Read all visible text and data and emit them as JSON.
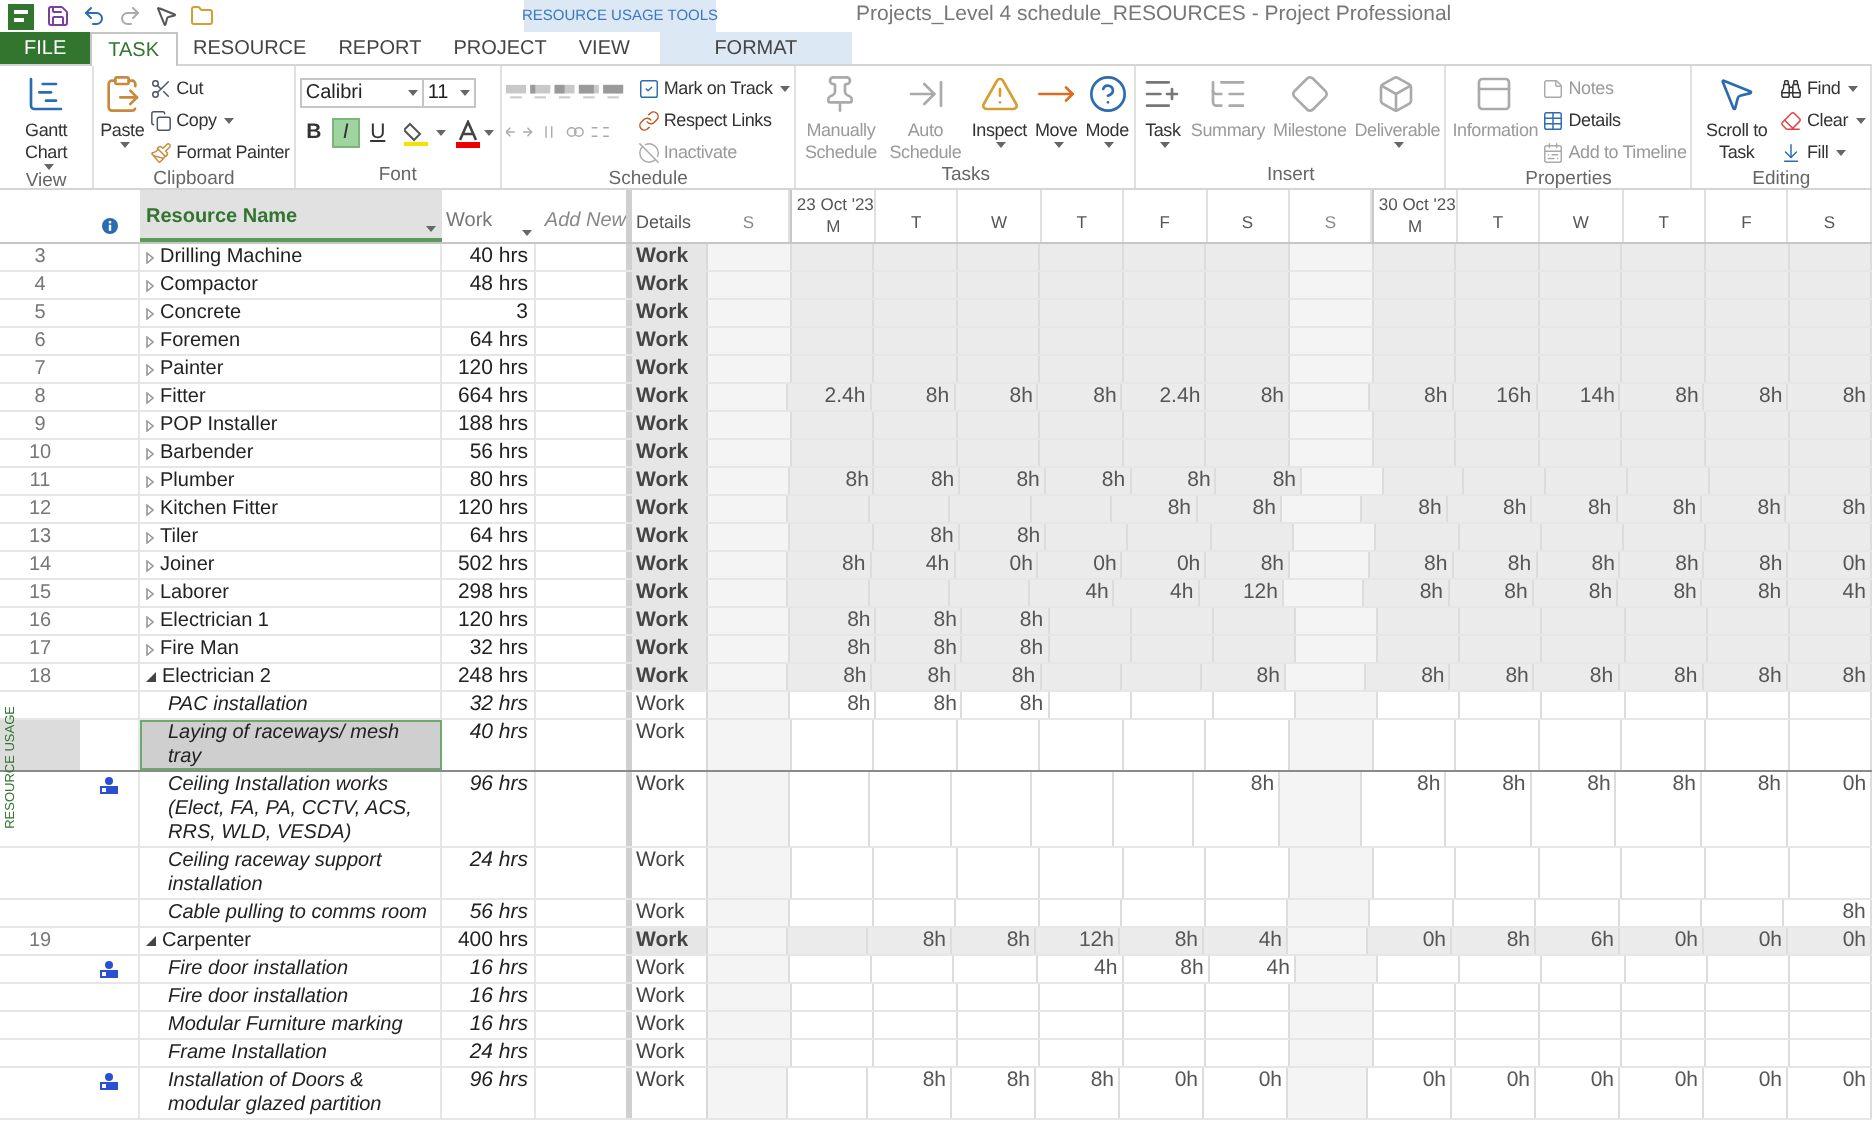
{
  "title": "Projects_Level 4 schedule_RESOURCES - Project Professional",
  "contextual_header": "RESOURCE USAGE TOOLS",
  "tabs": [
    {
      "label": "FILE",
      "kind": "file",
      "selected": false
    },
    {
      "label": "TASK",
      "kind": "normal",
      "selected": true
    },
    {
      "label": "RESOURCE",
      "kind": "normal",
      "selected": false
    },
    {
      "label": "REPORT",
      "kind": "normal",
      "selected": false
    },
    {
      "label": "PROJECT",
      "kind": "normal",
      "selected": false
    },
    {
      "label": "VIEW",
      "kind": "normal",
      "selected": false
    },
    {
      "label": "FORMAT",
      "kind": "contextual",
      "selected": false
    }
  ],
  "ribbon_groups": [
    {
      "label": "View",
      "kind": "buttons",
      "buttons": [
        {
          "kind": "large",
          "label": "Gantt Chart",
          "dropdown": true,
          "disabled": false
        }
      ]
    },
    {
      "label": "Clipboard",
      "kind": "buttons",
      "buttons": [
        {
          "kind": "large",
          "label": "Paste",
          "dropdown": true,
          "disabled": false
        },
        {
          "kind": "small",
          "label": "Cut",
          "dropdown": false,
          "disabled": false
        },
        {
          "kind": "small",
          "label": "Copy",
          "dropdown": true,
          "disabled": false
        },
        {
          "kind": "small",
          "label": "Format Painter",
          "dropdown": false,
          "disabled": false
        }
      ]
    },
    {
      "label": "Font",
      "kind": "font",
      "font": "Calibri",
      "size": "11",
      "styles": [
        {
          "label": "B",
          "selected": false
        },
        {
          "label": "I",
          "selected": true
        },
        {
          "label": "U",
          "selected": false
        }
      ]
    },
    {
      "label": "Schedule",
      "kind": "schedule",
      "buttons": [
        {
          "kind": "small",
          "label": "Mark on Track",
          "dropdown": true,
          "disabled": false
        },
        {
          "kind": "small",
          "label": "Respect Links",
          "dropdown": false,
          "disabled": false
        },
        {
          "kind": "small",
          "label": "Inactivate",
          "dropdown": false,
          "disabled": true
        }
      ]
    },
    {
      "label": "Tasks",
      "kind": "buttons",
      "buttons": [
        {
          "kind": "large",
          "label": "Manually Schedule",
          "dropdown": false,
          "disabled": true
        },
        {
          "kind": "large",
          "label": "Auto Schedule",
          "dropdown": false,
          "disabled": true
        },
        {
          "kind": "large",
          "label": "Inspect",
          "dropdown": true,
          "disabled": false
        },
        {
          "kind": "large",
          "label": "Move",
          "dropdown": true,
          "disabled": false
        },
        {
          "kind": "large",
          "label": "Mode",
          "dropdown": true,
          "disabled": false
        }
      ]
    },
    {
      "label": "Insert",
      "kind": "buttons",
      "buttons": [
        {
          "kind": "large",
          "label": "Task",
          "dropdown": true,
          "disabled": false
        },
        {
          "kind": "large",
          "label": "Summary",
          "dropdown": false,
          "disabled": true
        },
        {
          "kind": "large",
          "label": "Milestone",
          "dropdown": false,
          "disabled": true
        },
        {
          "kind": "large",
          "label": "Deliverable",
          "dropdown": true,
          "disabled": true
        }
      ]
    },
    {
      "label": "Properties",
      "kind": "buttons",
      "buttons": [
        {
          "kind": "large",
          "label": "Information",
          "dropdown": false,
          "disabled": true
        },
        {
          "kind": "small",
          "label": "Notes",
          "dropdown": false,
          "disabled": true
        },
        {
          "kind": "small",
          "label": "Details",
          "dropdown": false,
          "disabled": false
        },
        {
          "kind": "small",
          "label": "Add to Timeline",
          "dropdown": false,
          "disabled": true
        }
      ]
    },
    {
      "label": "Editing",
      "kind": "buttons",
      "buttons": [
        {
          "kind": "large",
          "label": "Scroll to Task",
          "dropdown": false,
          "disabled": false
        },
        {
          "kind": "small",
          "label": "Find",
          "dropdown": true,
          "disabled": false
        },
        {
          "kind": "small",
          "label": "Clear",
          "dropdown": true,
          "disabled": false
        },
        {
          "kind": "small",
          "label": "Fill",
          "dropdown": true,
          "disabled": false
        }
      ]
    }
  ],
  "view_bar": "RESOURCE USAGE",
  "columns": {
    "name": "Resource Name",
    "work": "Work",
    "add": "Add New",
    "details": "Details"
  },
  "days": [
    {
      "label": "S",
      "nonworking": true
    },
    {
      "label": "M",
      "week": "23 Oct '23",
      "nonworking": false
    },
    {
      "label": "T",
      "nonworking": false
    },
    {
      "label": "W",
      "nonworking": false
    },
    {
      "label": "T",
      "nonworking": false
    },
    {
      "label": "F",
      "nonworking": false
    },
    {
      "label": "S",
      "nonworking": false
    },
    {
      "label": "S",
      "nonworking": true
    },
    {
      "label": "M",
      "week": "30 Oct '23",
      "nonworking": false
    },
    {
      "label": "T",
      "nonworking": false
    },
    {
      "label": "W",
      "nonworking": false
    },
    {
      "label": "T",
      "nonworking": false
    },
    {
      "label": "F",
      "nonworking": false
    },
    {
      "label": "S",
      "nonworking": false
    }
  ],
  "rows": [
    {
      "kind": "resource",
      "id": "3",
      "name": "Drilling Machine",
      "work": "40 hrs",
      "details": "Work",
      "expanded": false,
      "indicator": false,
      "selected": false
    },
    {
      "kind": "resource",
      "id": "4",
      "name": "Compactor",
      "work": "48 hrs",
      "details": "Work",
      "expanded": false,
      "indicator": false,
      "selected": false
    },
    {
      "kind": "resource",
      "id": "5",
      "name": "Concrete",
      "work": "3",
      "details": "Work",
      "expanded": false,
      "indicator": false,
      "selected": false
    },
    {
      "kind": "resource",
      "id": "6",
      "name": "Foremen",
      "work": "64 hrs",
      "details": "Work",
      "expanded": false,
      "indicator": false,
      "selected": false
    },
    {
      "kind": "resource",
      "id": "7",
      "name": "Painter",
      "work": "120 hrs",
      "details": "Work",
      "expanded": false,
      "indicator": false,
      "selected": false
    },
    {
      "kind": "resource",
      "id": "8",
      "name": "Fitter",
      "work": "664 hrs",
      "details": "Work",
      "expanded": false,
      "indicator": false,
      "selected": false,
      "hours": {
        "1": "2.4h",
        "2": "8h",
        "3": "8h",
        "4": "8h",
        "5": "2.4h",
        "6": "8h",
        "8": "8h",
        "9": "16h",
        "10": "14h",
        "11": "8h",
        "12": "8h",
        "13": "8h"
      }
    },
    {
      "kind": "resource",
      "id": "9",
      "name": "POP Installer",
      "work": "188 hrs",
      "details": "Work",
      "expanded": false,
      "indicator": false,
      "selected": false
    },
    {
      "kind": "resource",
      "id": "10",
      "name": "Barbender",
      "work": "56 hrs",
      "details": "Work",
      "expanded": false,
      "indicator": false,
      "selected": false
    },
    {
      "kind": "resource",
      "id": "11",
      "name": "Plumber",
      "work": "80 hrs",
      "details": "Work",
      "expanded": false,
      "indicator": false,
      "selected": false,
      "hours": {
        "1": "8h",
        "2": "8h",
        "3": "8h",
        "4": "8h",
        "5": "8h",
        "6": "8h"
      }
    },
    {
      "kind": "resource",
      "id": "12",
      "name": "Kitchen Fitter",
      "work": "120 hrs",
      "details": "Work",
      "expanded": false,
      "indicator": false,
      "selected": false,
      "hours": {
        "5": "8h",
        "6": "8h",
        "8": "8h",
        "9": "8h",
        "10": "8h",
        "11": "8h",
        "12": "8h",
        "13": "8h"
      }
    },
    {
      "kind": "resource",
      "id": "13",
      "name": "Tiler",
      "work": "64 hrs",
      "details": "Work",
      "expanded": false,
      "indicator": false,
      "selected": false,
      "hours": {
        "2": "8h",
        "3": "8h"
      }
    },
    {
      "kind": "resource",
      "id": "14",
      "name": "Joiner",
      "work": "502 hrs",
      "details": "Work",
      "expanded": false,
      "indicator": false,
      "selected": false,
      "hours": {
        "1": "8h",
        "2": "4h",
        "3": "0h",
        "4": "0h",
        "5": "0h",
        "6": "8h",
        "8": "8h",
        "9": "8h",
        "10": "8h",
        "11": "8h",
        "12": "8h",
        "13": "0h"
      }
    },
    {
      "kind": "resource",
      "id": "15",
      "name": "Laborer",
      "work": "298 hrs",
      "details": "Work",
      "expanded": false,
      "indicator": false,
      "selected": false,
      "hours": {
        "4": "4h",
        "5": "4h",
        "6": "12h",
        "8": "8h",
        "9": "8h",
        "10": "8h",
        "11": "8h",
        "12": "8h",
        "13": "4h"
      }
    },
    {
      "kind": "resource",
      "id": "16",
      "name": "Electrician 1",
      "work": "120 hrs",
      "details": "Work",
      "expanded": false,
      "indicator": false,
      "selected": false,
      "hours": {
        "1": "8h",
        "2": "8h",
        "3": "8h"
      }
    },
    {
      "kind": "resource",
      "id": "17",
      "name": "Fire Man",
      "work": "32 hrs",
      "details": "Work",
      "expanded": false,
      "indicator": false,
      "selected": false,
      "hours": {
        "1": "8h",
        "2": "8h",
        "3": "8h"
      }
    },
    {
      "kind": "resource",
      "id": "18",
      "name": "Electrician 2",
      "work": "248 hrs",
      "details": "Work",
      "expanded": true,
      "indicator": false,
      "selected": false,
      "hours": {
        "1": "8h",
        "2": "8h",
        "3": "8h",
        "6": "8h",
        "8": "8h",
        "9": "8h",
        "10": "8h",
        "11": "8h",
        "12": "8h",
        "13": "8h"
      }
    },
    {
      "kind": "assignment",
      "name": "PAC installation",
      "work": "32 hrs",
      "details": "Work",
      "indicator": false,
      "selected": false,
      "hours": {
        "1": "8h",
        "2": "8h",
        "3": "8h"
      }
    },
    {
      "kind": "assignment",
      "name": "Laying of raceways/ mesh tray",
      "work": "40 hrs",
      "details": "Work",
      "indicator": false,
      "selected": true
    },
    {
      "kind": "assignment",
      "name": "Ceiling Installation works (Elect, FA, PA, CCTV, ACS, RRS, WLD, VESDA)",
      "work": "96 hrs",
      "details": "Work",
      "indicator": true,
      "selected": false,
      "hours": {
        "6": "8h",
        "8": "8h",
        "9": "8h",
        "10": "8h",
        "11": "8h",
        "12": "8h",
        "13": "0h"
      }
    },
    {
      "kind": "assignment",
      "name": "Ceiling raceway support installation",
      "work": "24 hrs",
      "details": "Work",
      "indicator": false,
      "selected": false
    },
    {
      "kind": "assignment",
      "name": "Cable pulling to comms room",
      "work": "56 hrs",
      "details": "Work",
      "indicator": false,
      "selected": false,
      "hours": {
        "13": "8h"
      }
    },
    {
      "kind": "resource",
      "id": "19",
      "name": "Carpenter",
      "work": "400 hrs",
      "details": "Work",
      "expanded": true,
      "indicator": false,
      "selected": false,
      "hours": {
        "2": "8h",
        "3": "8h",
        "4": "12h",
        "5": "8h",
        "6": "4h",
        "8": "0h",
        "9": "8h",
        "10": "6h",
        "11": "0h",
        "12": "0h",
        "13": "0h"
      }
    },
    {
      "kind": "assignment",
      "name": "Fire door installation",
      "work": "16 hrs",
      "details": "Work",
      "indicator": true,
      "selected": false,
      "hours": {
        "4": "4h",
        "5": "8h",
        "6": "4h"
      }
    },
    {
      "kind": "assignment",
      "name": "Fire door installation",
      "work": "16 hrs",
      "details": "Work",
      "indicator": false,
      "selected": false
    },
    {
      "kind": "assignment",
      "name": "Modular Furniture marking",
      "work": "16 hrs",
      "details": "Work",
      "indicator": false,
      "selected": false
    },
    {
      "kind": "assignment",
      "name": "Frame Installation",
      "work": "24 hrs",
      "details": "Work",
      "indicator": false,
      "selected": false
    },
    {
      "kind": "assignment",
      "name": "Installation of Doors & modular glazed partition",
      "work": "96 hrs",
      "details": "Work",
      "indicator": true,
      "selected": false,
      "hours": {
        "2": "8h",
        "3": "8h",
        "4": "8h",
        "5": "0h",
        "6": "0h",
        "8": "0h",
        "9": "0h",
        "10": "0h",
        "11": "0h",
        "12": "0h",
        "13": "0h"
      }
    }
  ]
}
